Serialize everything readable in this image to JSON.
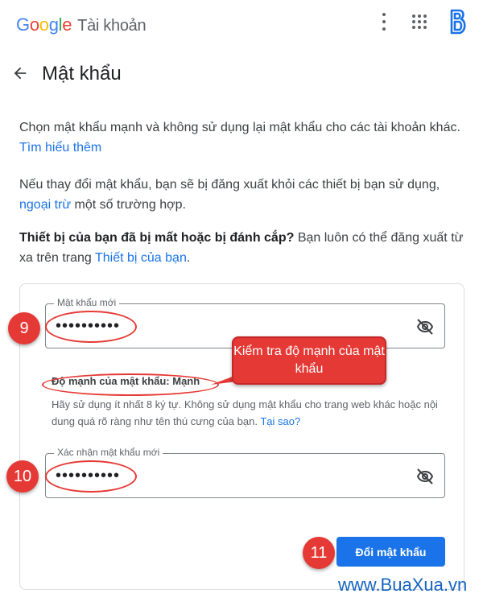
{
  "header": {
    "logo_letters": [
      "G",
      "o",
      "o",
      "g",
      "l",
      "e"
    ],
    "product": "Tài khoản",
    "more_icon": "more-vert-icon",
    "apps_icon": "apps-grid-icon",
    "account_icon": "account-avatar-icon"
  },
  "page": {
    "title": "Mật khẩu",
    "back_icon": "arrow-back-icon"
  },
  "intro": {
    "text": "Chọn mật khẩu mạnh và không sử dụng lại mật khẩu cho các tài khoản khác.",
    "link": "Tìm hiểu thêm"
  },
  "signout": {
    "text_before": "Nếu thay đổi mật khẩu, bạn sẽ bị đăng xuất khỏi các thiết bị bạn sử dụng,",
    "link": "ngoại trừ",
    "text_after": "một số trường hợp."
  },
  "lost": {
    "bold": "Thiết bị của bạn đã bị mất hoặc bị đánh cắp?",
    "text": "Bạn luôn có thể đăng xuất từ xa trên trang",
    "link": "Thiết bị của bạn",
    "end": "."
  },
  "form": {
    "new_password": {
      "label": "Mật khẩu mới",
      "value": "••••••••••",
      "eye_icon": "visibility-off-icon"
    },
    "strength": "Độ mạnh của mật khẩu: Mạnh",
    "hint": "Hãy sử dụng ít nhất 8 ký tự. Không sử dụng mật khẩu cho trang web khác hoặc nội dung quá rõ ràng như tên thú cưng của bạn.",
    "hint_link": "Tại sao?",
    "confirm_password": {
      "label": "Xác nhận mật khẩu mới",
      "value": "••••••••••",
      "eye_icon": "visibility-off-icon"
    },
    "submit": "Đổi mật khẩu"
  },
  "annotations": {
    "step_9": "9",
    "step_10": "10",
    "step_11": "11",
    "callout": "Kiểm tra độ mạnh của mật khẩu",
    "accent_color": "#e53935"
  },
  "watermark": "www.BuaXua.vn",
  "colors": {
    "primary": "#1a73e8",
    "text": "#202124",
    "muted": "#5f6368"
  }
}
